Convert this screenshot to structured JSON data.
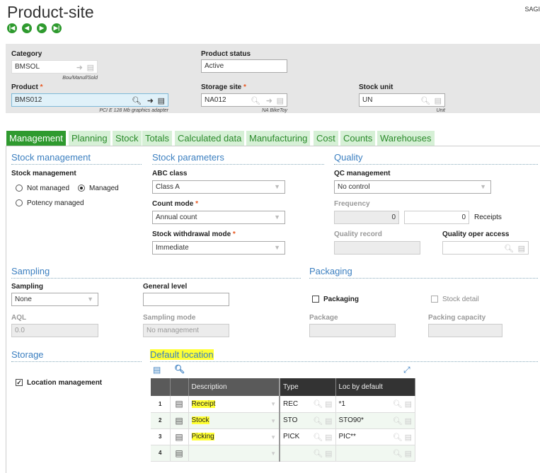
{
  "header": {
    "title": "Product-site",
    "user": "SAGI",
    "nav": [
      "first-record",
      "previous-record",
      "next-record",
      "last-record"
    ]
  },
  "panel": {
    "category": {
      "label": "Category",
      "value": "BMSOL",
      "sub": "Bou/Manuf/Sold"
    },
    "product_status": {
      "label": "Product status",
      "value": "Active"
    },
    "product": {
      "label": "Product",
      "value": "BMS012",
      "sub": "PCI E 128 Mb graphics adapter"
    },
    "storage_site": {
      "label": "Storage site",
      "value": "NA012",
      "sub": "NA BikeToy"
    },
    "stock_unit": {
      "label": "Stock unit",
      "value": "UN",
      "sub": "Unit"
    },
    "required": "*"
  },
  "tabs": [
    "Management",
    "Planning",
    "Stock",
    "Totals",
    "Calculated data",
    "Manufacturing",
    "Cost",
    "Counts",
    "Warehouses"
  ],
  "stock_management": {
    "title": "Stock management",
    "label": "Stock management",
    "options": [
      "Not managed",
      "Managed",
      "Potency managed"
    ],
    "selected": "Managed"
  },
  "stock_parameters": {
    "title": "Stock parameters",
    "abc_label": "ABC class",
    "abc_value": "Class A",
    "count_label": "Count mode",
    "count_value": "Annual count",
    "withdrawal_label": "Stock withdrawal mode",
    "withdrawal_value": "Immediate"
  },
  "quality": {
    "title": "Quality",
    "qc_label": "QC management",
    "qc_value": "No control",
    "frequency_label": "Frequency",
    "freq1": "0",
    "freq2": "0",
    "receipts": "Receipts",
    "record_label": "Quality record",
    "oper_label": "Quality oper access"
  },
  "sampling": {
    "title": "Sampling",
    "sampling_label": "Sampling",
    "sampling_value": "None",
    "general_label": "General level",
    "aql_label": "AQL",
    "aql_value": "0.0",
    "mode_label": "Sampling mode",
    "mode_value": "No management"
  },
  "packaging": {
    "title": "Packaging",
    "packaging_label": "Packaging",
    "stock_detail": "Stock detail",
    "package_label": "Package",
    "capacity_label": "Packing capacity"
  },
  "storage": {
    "title": "Storage",
    "location_management": "Location management"
  },
  "default_location": {
    "title": "Default location",
    "columns": [
      "Description",
      "Type",
      "Loc by default"
    ],
    "rows": [
      {
        "n": "1",
        "description": "Receipt",
        "type": "REC",
        "loc": "*1"
      },
      {
        "n": "2",
        "description": "Stock",
        "type": "STO",
        "loc": "STO90*"
      },
      {
        "n": "3",
        "description": "Picking",
        "type": "PICK",
        "loc": "PIC**"
      },
      {
        "n": "4",
        "description": "",
        "type": "",
        "loc": ""
      }
    ]
  }
}
